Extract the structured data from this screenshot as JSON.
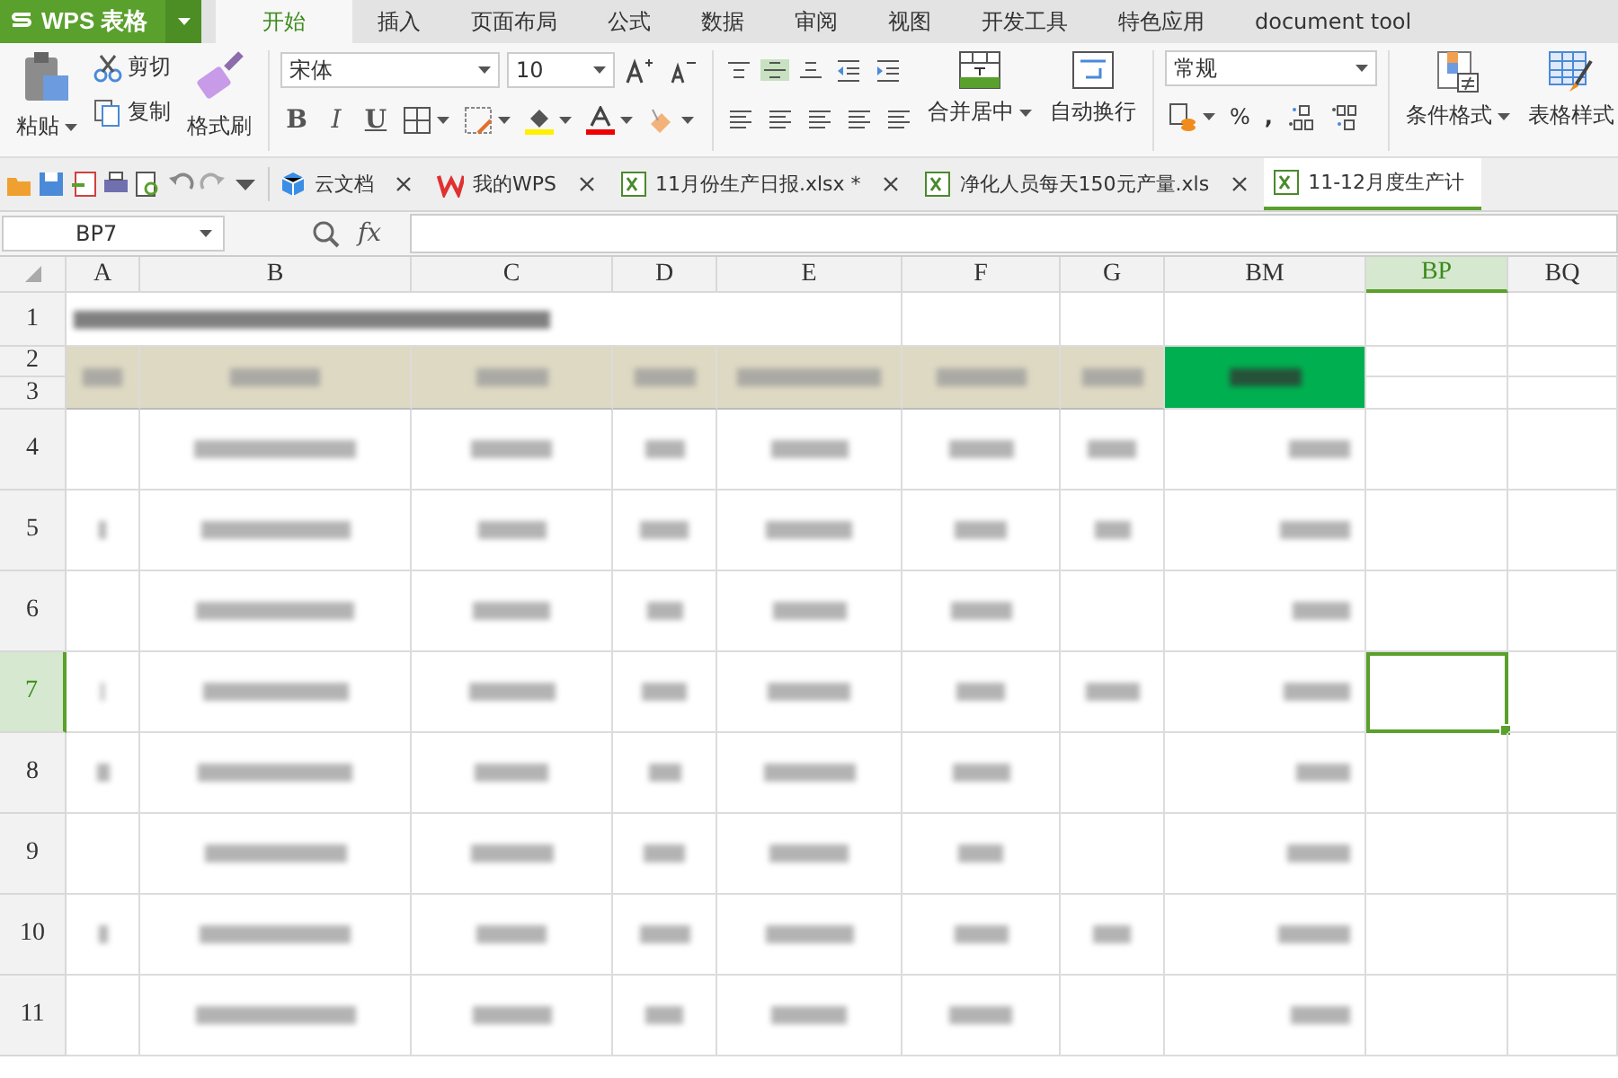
{
  "app_button": {
    "label": "WPS 表格"
  },
  "menu_tabs": [
    {
      "label": "开始",
      "selected": true
    },
    {
      "label": "插入",
      "selected": false
    },
    {
      "label": "页面布局",
      "selected": false
    },
    {
      "label": "公式",
      "selected": false
    },
    {
      "label": "数据",
      "selected": false
    },
    {
      "label": "审阅",
      "selected": false
    },
    {
      "label": "视图",
      "selected": false
    },
    {
      "label": "开发工具",
      "selected": false
    },
    {
      "label": "特色应用",
      "selected": false
    },
    {
      "label": "document tool",
      "selected": false
    }
  ],
  "clipboard": {
    "paste": "粘贴",
    "cut": "剪切",
    "copy": "复制",
    "format_painter": "格式刷"
  },
  "font": {
    "name": "宋体",
    "size": "10",
    "styles": [
      "B",
      "I",
      "U"
    ]
  },
  "alignment": {
    "merge": "合并居中",
    "wrap": "自动换行",
    "vertical": [
      {
        "kind": "top",
        "selected": false
      },
      {
        "kind": "middle",
        "selected": true
      },
      {
        "kind": "bottom",
        "selected": false
      }
    ]
  },
  "number": {
    "format": "常规",
    "percent": "%",
    "comma": ","
  },
  "styles": {
    "conditional": "条件格式",
    "table": "表格样式"
  },
  "doc_tabs": [
    {
      "kind": "cloud",
      "label": "云文档",
      "selected": false
    },
    {
      "kind": "wps",
      "label": "我的WPS",
      "selected": false
    },
    {
      "kind": "sheet",
      "label": "11月份生产日报.xlsx *",
      "selected": false
    },
    {
      "kind": "sheet",
      "label": "净化人员每天150元产量.xls",
      "selected": false
    },
    {
      "kind": "sheet",
      "label": "11-12月度生产计",
      "selected": true
    }
  ],
  "formula_bar": {
    "name_box": "BP7",
    "fx": "fx"
  },
  "sheet": {
    "columns": [
      {
        "label": "A",
        "selected": false
      },
      {
        "label": "B",
        "selected": false
      },
      {
        "label": "C",
        "selected": false
      },
      {
        "label": "D",
        "selected": false
      },
      {
        "label": "E",
        "selected": false
      },
      {
        "label": "F",
        "selected": false
      },
      {
        "label": "G",
        "selected": false
      },
      {
        "label": "BM",
        "selected": false
      },
      {
        "label": "BP",
        "selected": true
      },
      {
        "label": "BQ",
        "selected": false
      }
    ],
    "rows": [
      {
        "label": "1",
        "selected": false
      },
      {
        "label": "2",
        "selected": false
      },
      {
        "label": "3",
        "selected": false
      },
      {
        "label": "4",
        "selected": false
      },
      {
        "label": "5",
        "selected": false
      },
      {
        "label": "6",
        "selected": false
      },
      {
        "label": "7",
        "selected": true
      },
      {
        "label": "8",
        "selected": false
      },
      {
        "label": "9",
        "selected": false
      },
      {
        "label": "10",
        "selected": false
      },
      {
        "label": "11",
        "selected": false
      }
    ]
  }
}
